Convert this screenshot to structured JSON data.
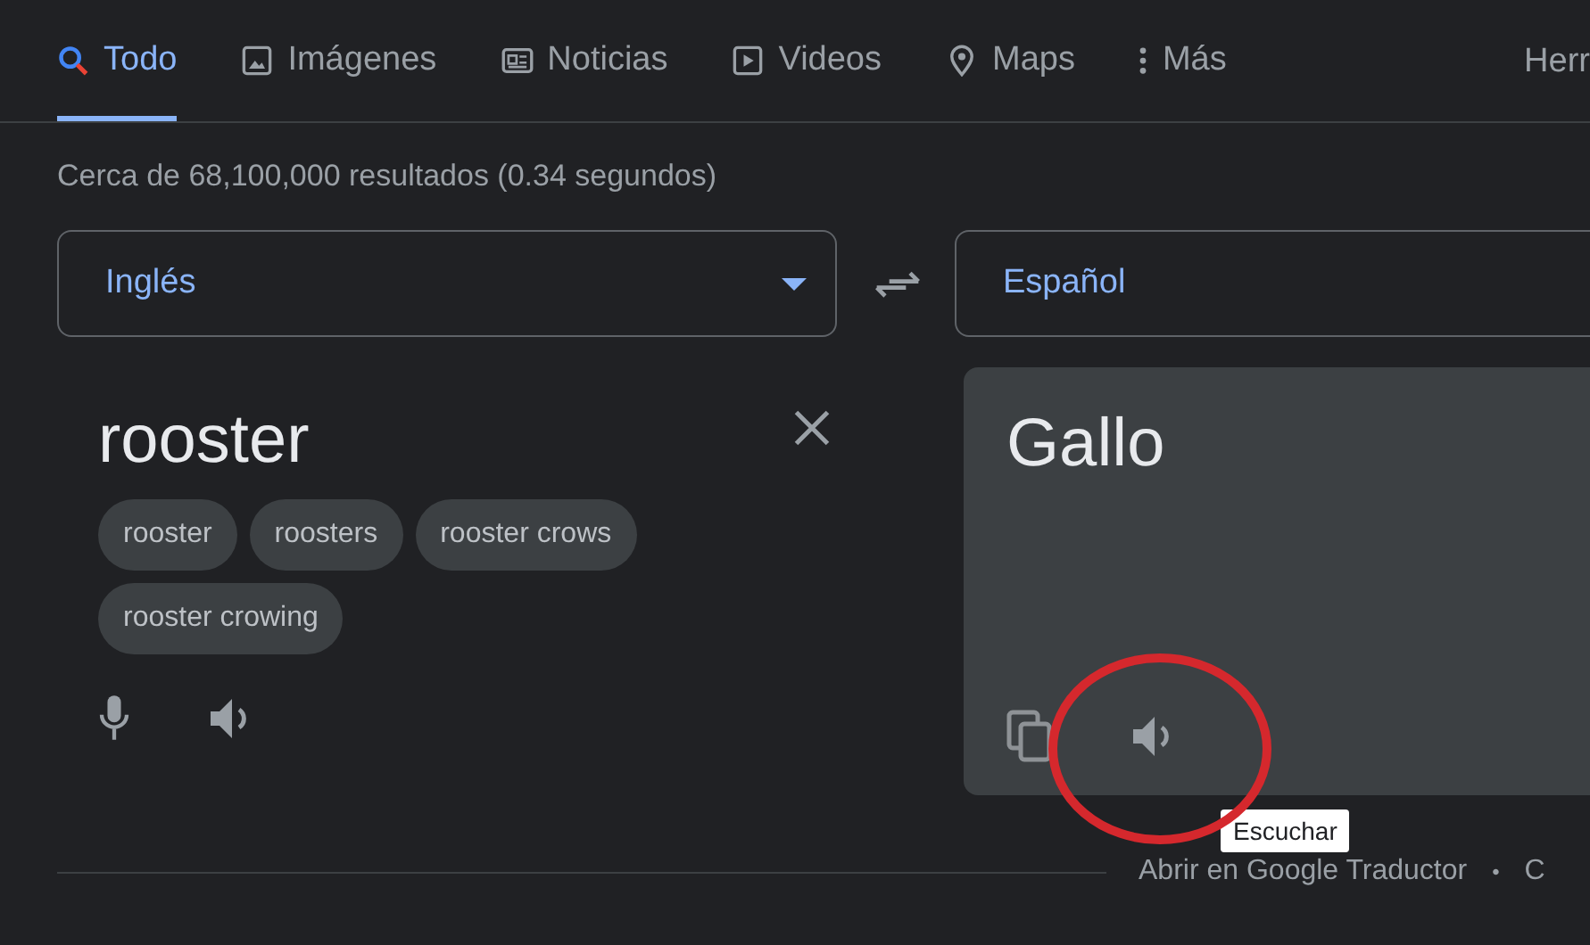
{
  "tabs": [
    {
      "label": "Todo",
      "kind": "search",
      "selected": true
    },
    {
      "label": "Imágenes",
      "kind": "image",
      "selected": false
    },
    {
      "label": "Noticias",
      "kind": "news",
      "selected": false
    },
    {
      "label": "Videos",
      "kind": "video",
      "selected": false
    },
    {
      "label": "Maps",
      "kind": "pin",
      "selected": false
    },
    {
      "label": "Más",
      "kind": "more",
      "selected": false
    }
  ],
  "tools_link": "Herr",
  "result_stats": "Cerca de 68,100,000 resultados (0.34 segundos)",
  "source_language": {
    "label": "Inglés"
  },
  "target_language": {
    "label": "Español"
  },
  "source_text": "rooster",
  "suggestions": [
    "rooster",
    "roosters",
    "rooster crows",
    "rooster crowing"
  ],
  "translation": "Gallo",
  "tooltip": "Escuchar",
  "footer": {
    "links": [
      "Abrir en Google Traductor",
      "C"
    ],
    "separator": "•"
  }
}
